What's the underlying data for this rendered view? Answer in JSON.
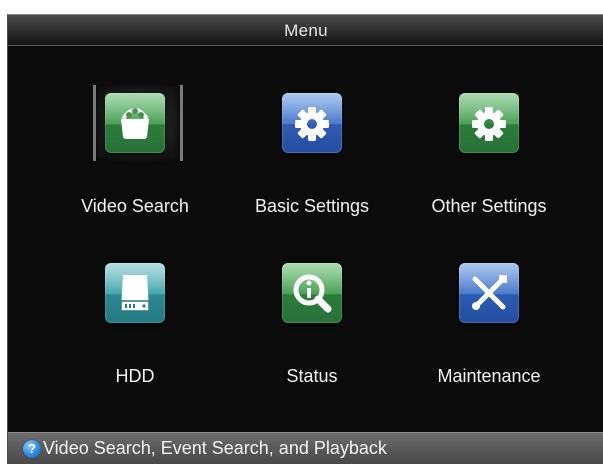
{
  "window": {
    "title": "Menu"
  },
  "menu": {
    "items": [
      {
        "label": "Video Search",
        "icon": "video-search-icon",
        "color": "#3f9a4b",
        "selected": true
      },
      {
        "label": "Basic Settings",
        "icon": "gear-icon",
        "color": "#3e70c7",
        "selected": false
      },
      {
        "label": "Other Settings",
        "icon": "gear-icon",
        "color": "#3f9a4b",
        "selected": false
      },
      {
        "label": "HDD",
        "icon": "hdd-icon",
        "color": "#3c9fa8",
        "selected": false
      },
      {
        "label": "Status",
        "icon": "status-magnifier-icon",
        "color": "#3f9a4b",
        "selected": false
      },
      {
        "label": "Maintenance",
        "icon": "tools-icon",
        "color": "#3e70c7",
        "selected": false
      }
    ]
  },
  "statusbar": {
    "help_icon": "help-icon",
    "text": "Video Search, Event Search, and Playback"
  },
  "colors": {
    "background": "#0b0b0b",
    "titlebar": "#2c2c2c",
    "statusbar": "#595959",
    "text": "#f2f2f2"
  }
}
